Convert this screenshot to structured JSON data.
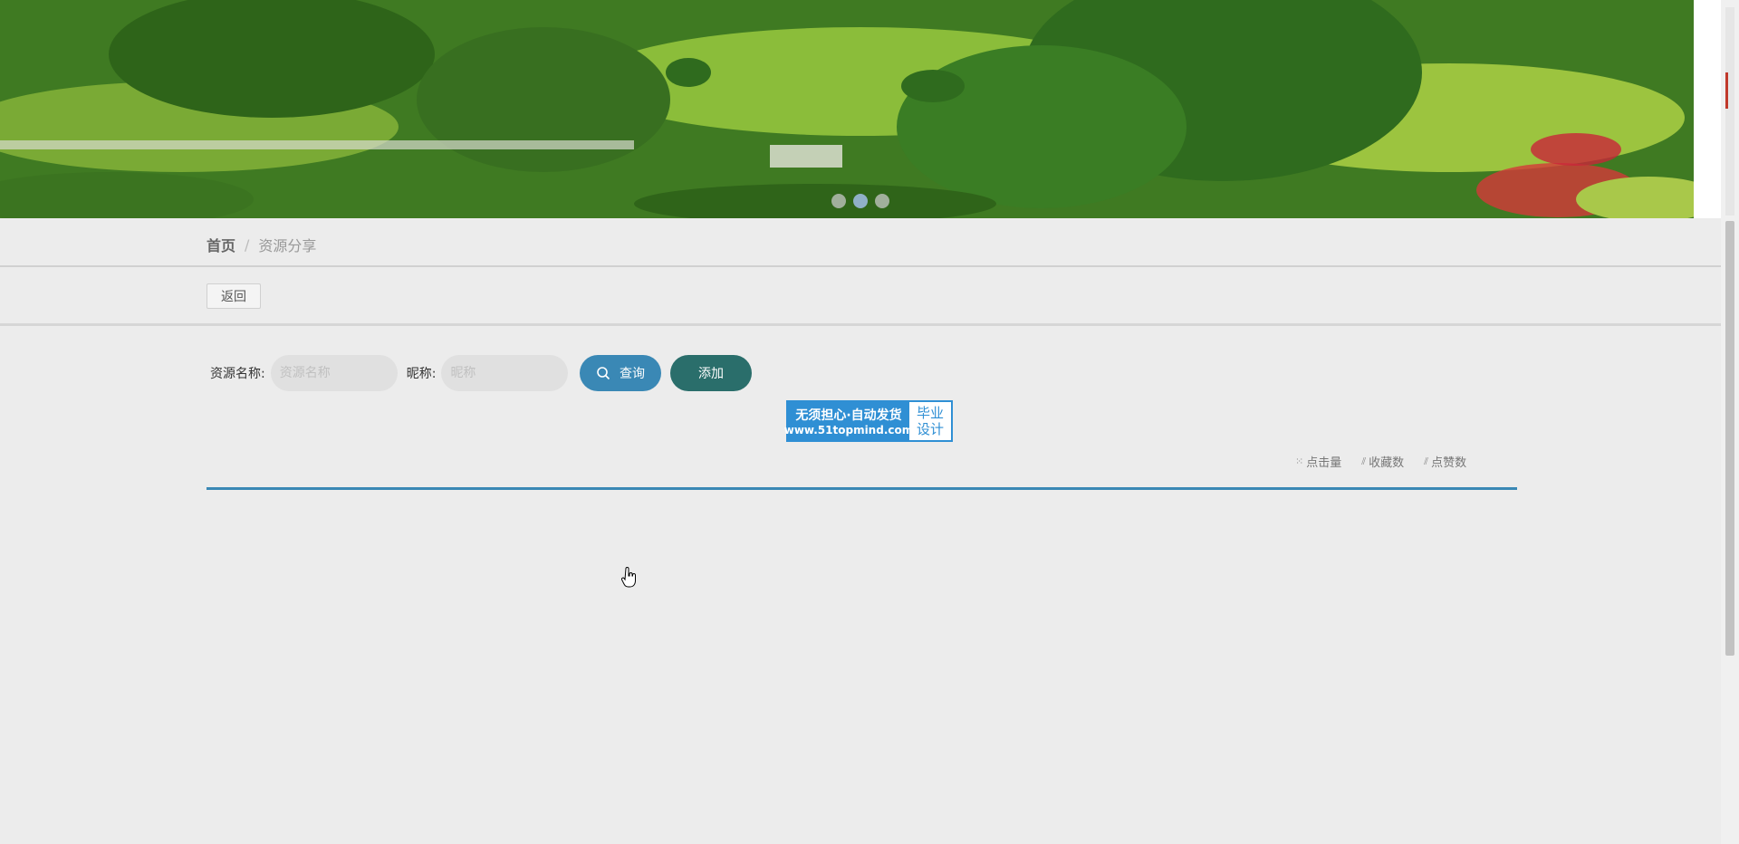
{
  "breadcrumb": {
    "home": "首页",
    "separator": "/",
    "current": "资源分享"
  },
  "back_button": "返回",
  "search": {
    "name_label": "资源名称:",
    "name_placeholder": "资源名称",
    "nickname_label": "昵称:",
    "nickname_placeholder": "昵称",
    "query_button": "查询",
    "add_button": "添加"
  },
  "logo": {
    "line1": "无须担心·自动发货",
    "line2": "www.51topmind.com",
    "right1": "毕业",
    "right2": "设计"
  },
  "sorts": [
    {
      "icon": "grid-icon",
      "label": "点击量"
    },
    {
      "icon": "chart-icon",
      "label": "收藏数"
    },
    {
      "icon": "chart-icon",
      "label": "点赞数"
    }
  ],
  "carousel": {
    "slides": 3,
    "active_index": 1
  }
}
